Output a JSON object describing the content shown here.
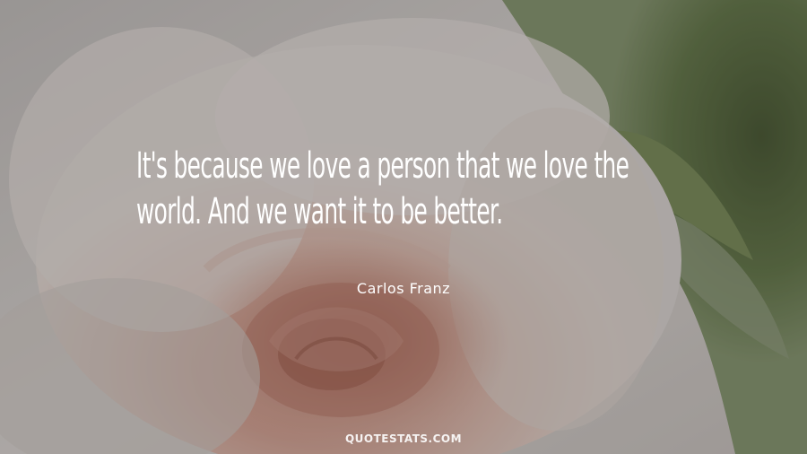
{
  "quote": {
    "lines": [
      "It's because we love a person that we love the",
      "world. And we want it to be better."
    ]
  },
  "author": "Carlos Franz",
  "watermark": "QUOTESTATS.COM",
  "colors": {
    "text": "#ffffff",
    "overlay": "#1e1c1c",
    "petal_light": "#e8dcd6",
    "petal_pink": "#d9a494",
    "leaf_green": "#5d6e44"
  }
}
